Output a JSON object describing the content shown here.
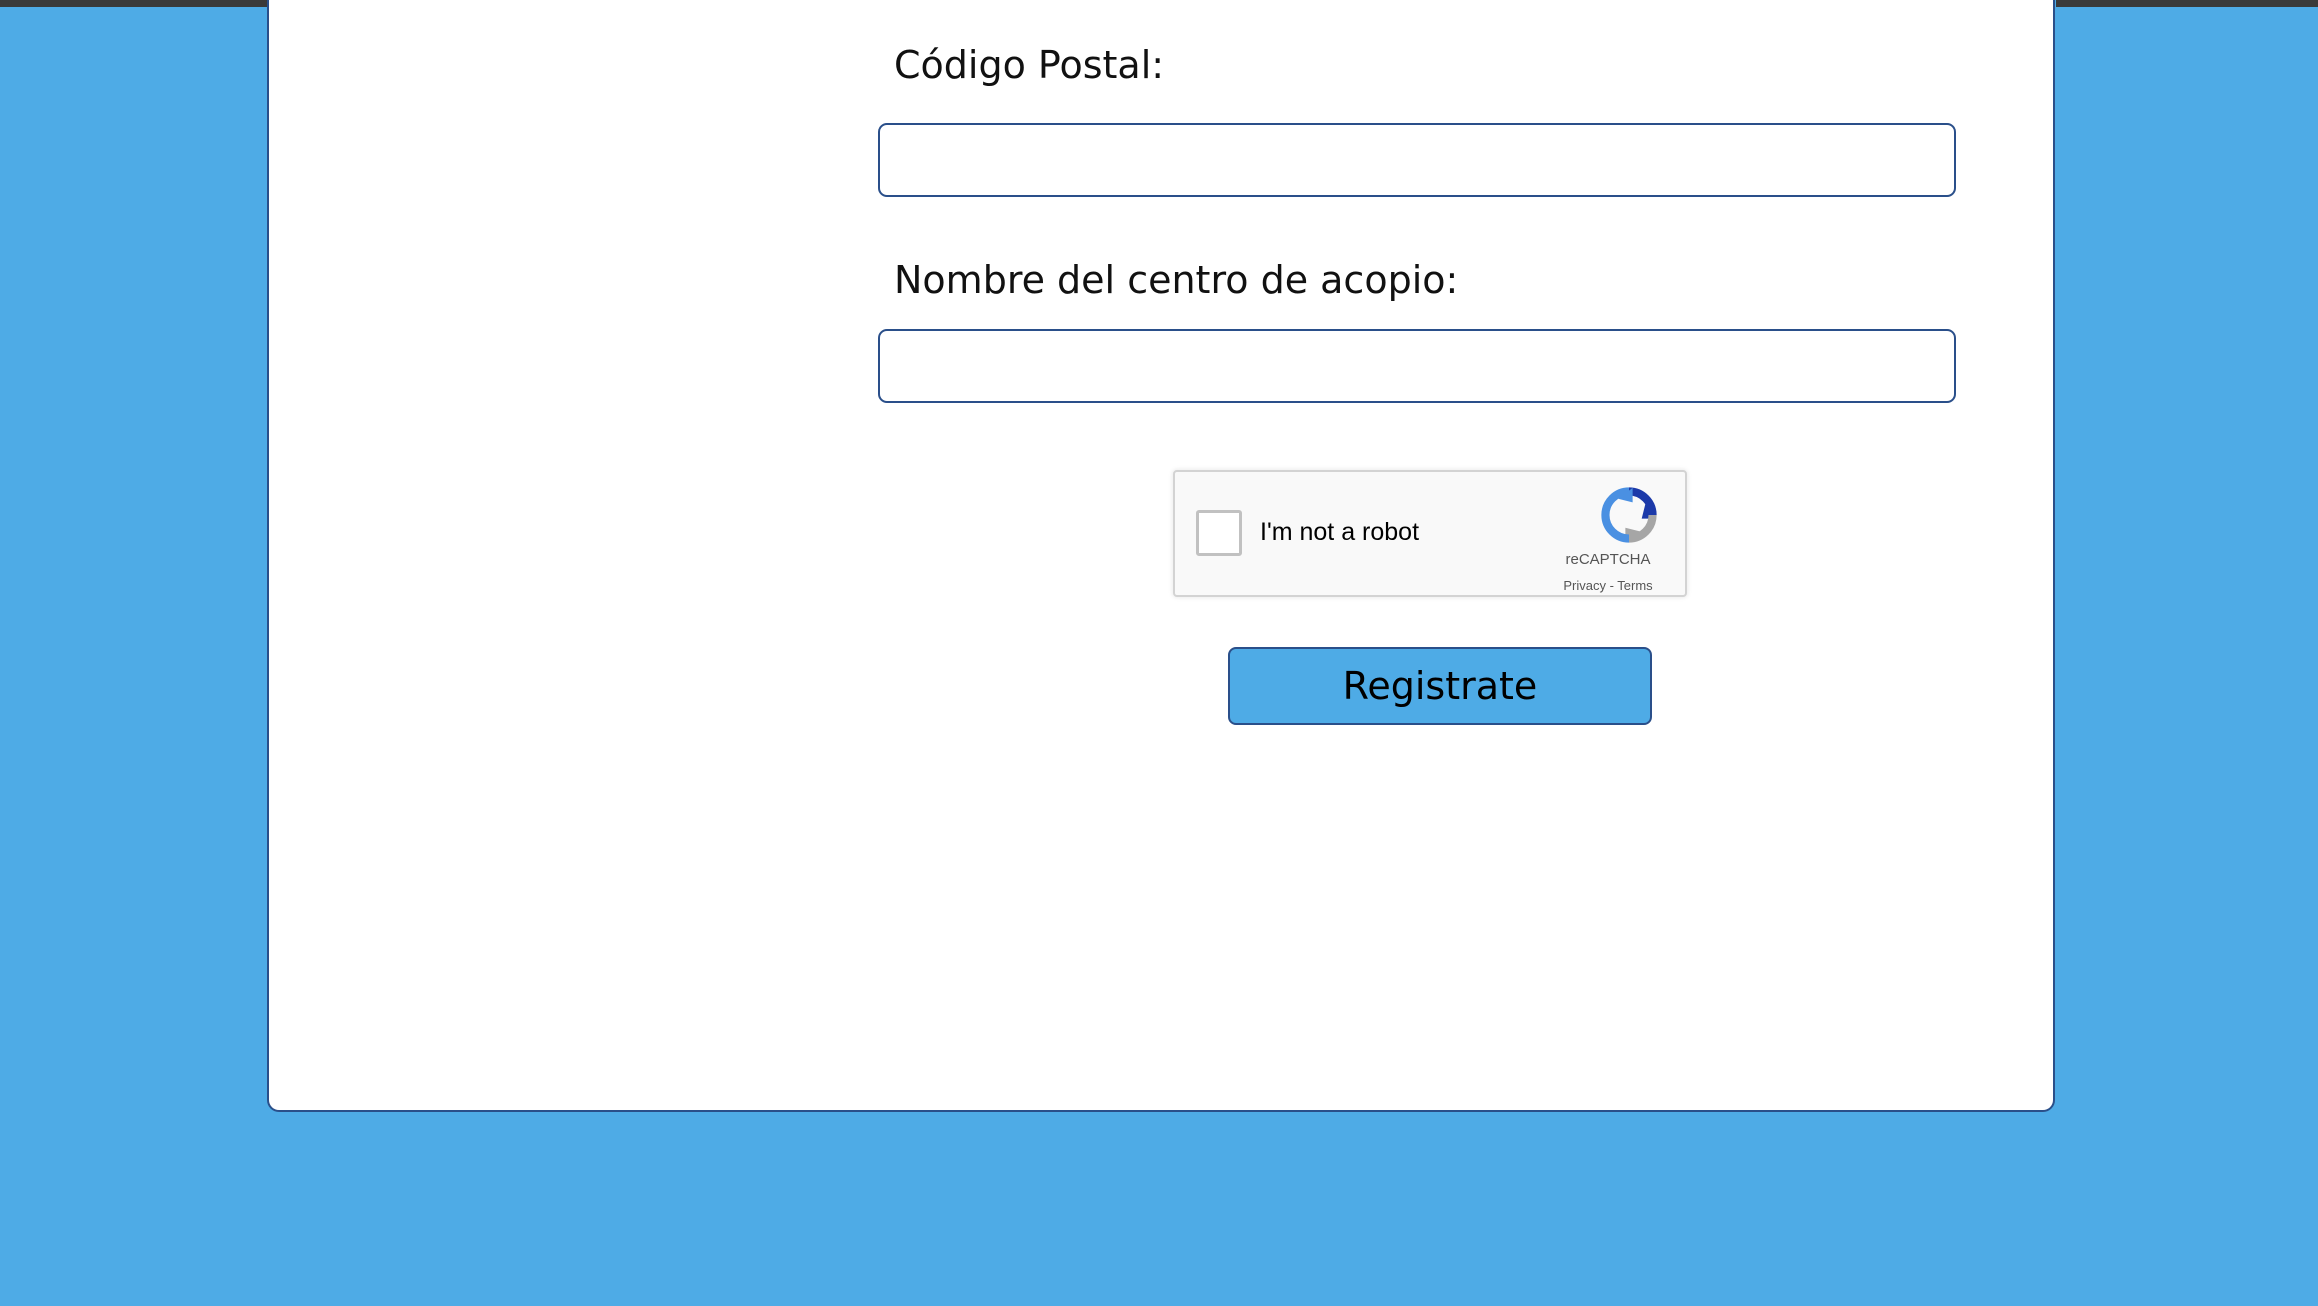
{
  "form": {
    "postal_code": {
      "label": "Código Postal:",
      "value": "",
      "placeholder": ""
    },
    "center_name": {
      "label": "Nombre del centro de acopio:",
      "value": "",
      "placeholder": ""
    },
    "submit_label": "Registrate"
  },
  "recaptcha": {
    "label": "I'm not a robot",
    "brand": "reCAPTCHA",
    "privacy": "Privacy",
    "separator": " - ",
    "terms": "Terms",
    "checked": false,
    "icon": "recaptcha-logo-icon"
  },
  "colors": {
    "background": "#4eabe6",
    "card": "#ffffff",
    "border": "#2a4f8a",
    "button": "#4eabe6"
  }
}
